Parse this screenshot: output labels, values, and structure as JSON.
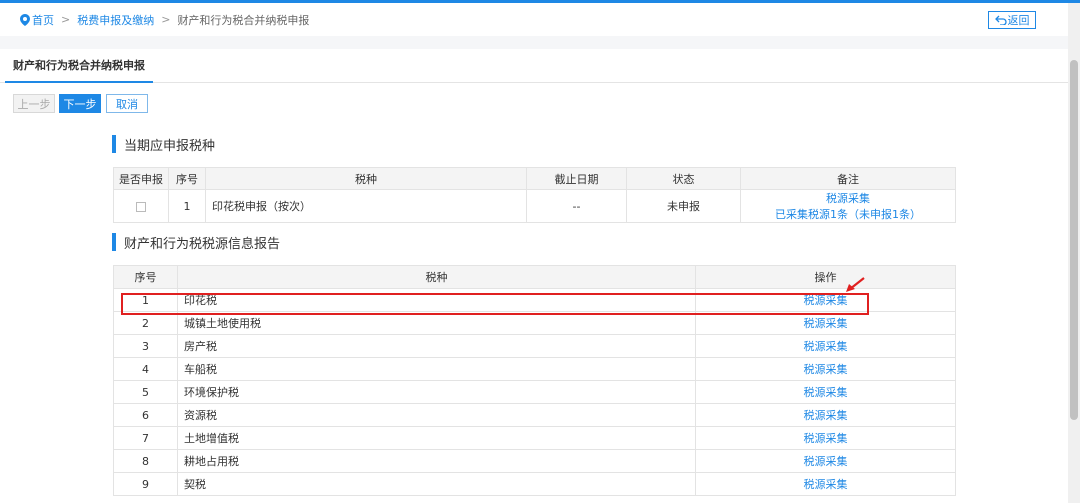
{
  "breadcrumb": {
    "home": "首页",
    "parent": "税费申报及缴纳",
    "current": "财产和行为税合并纳税申报"
  },
  "back_label": "返回",
  "tab": "财产和行为税合并纳税申报",
  "buttons": {
    "prev": "上一步",
    "next": "下一步",
    "cancel": "取消"
  },
  "section1": {
    "title": "当期应申报税种",
    "headers": [
      "是否申报",
      "序号",
      "税种",
      "截止日期",
      "状态",
      "备注"
    ],
    "rows": [
      {
        "no": "1",
        "tax": "印花税申报（按次）",
        "deadline": "--",
        "status": "未申报",
        "remark_link": "税源采集",
        "remark_text": "已采集税源1条（未申报1条）"
      }
    ]
  },
  "section2": {
    "title": "财产和行为税税源信息报告",
    "headers": [
      "序号",
      "税种",
      "操作"
    ],
    "action": "税源采集",
    "rows": [
      {
        "no": "1",
        "tax": "印花税"
      },
      {
        "no": "2",
        "tax": "城镇土地使用税"
      },
      {
        "no": "3",
        "tax": "房产税"
      },
      {
        "no": "4",
        "tax": "车船税"
      },
      {
        "no": "5",
        "tax": "环境保护税"
      },
      {
        "no": "6",
        "tax": "资源税"
      },
      {
        "no": "7",
        "tax": "土地增值税"
      },
      {
        "no": "8",
        "tax": "耕地占用税"
      },
      {
        "no": "9",
        "tax": "契税"
      }
    ]
  },
  "colors": {
    "accent": "#1e88e5",
    "highlight": "#e02020"
  },
  "icons": {
    "location": "location-pin-icon",
    "back": "return-arrow-icon"
  }
}
